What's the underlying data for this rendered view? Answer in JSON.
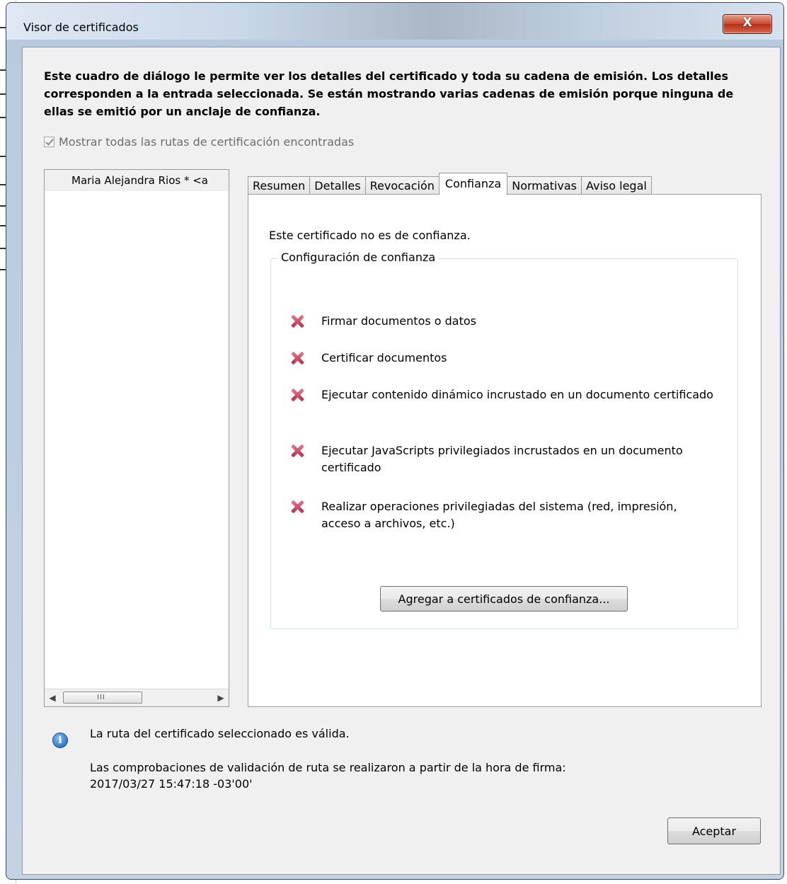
{
  "window": {
    "title": "Visor de certificados",
    "close_glyph": "X"
  },
  "intro": "Este cuadro de diálogo le permite ver los detalles del certificado y toda su cadena de emisión. Los detalles corresponden a la entrada seleccionada. Se están mostrando varias cadenas de emisión porque ninguna de ellas se emitió por un anclaje de confianza.",
  "show_all": {
    "label": "Mostrar todas las rutas de certificación encontradas",
    "checked": true,
    "disabled": true
  },
  "tree": {
    "items": [
      {
        "label": "Maria Alejandra  Rios * <a"
      }
    ],
    "scroll_grip": "III"
  },
  "tabs": [
    {
      "label": "Resumen",
      "active": false
    },
    {
      "label": "Detalles",
      "active": false
    },
    {
      "label": "Revocación",
      "active": false
    },
    {
      "label": "Confianza",
      "active": true
    },
    {
      "label": "Normativas",
      "active": false
    },
    {
      "label": "Aviso legal",
      "active": false
    }
  ],
  "trust": {
    "status": "Este certificado no es de confianza.",
    "group_title": "Configuración de confianza",
    "permissions": [
      {
        "text": "Firmar documentos o datos",
        "icon": "red-x-icon"
      },
      {
        "text": "Certificar documentos",
        "icon": "red-x-icon"
      },
      {
        "text": "Ejecutar contenido dinámico incrustado en un documento certificado",
        "icon": "red-x-icon"
      },
      {
        "text": "Ejecutar JavaScripts privilegiados incrustados en un documento certificado",
        "icon": "red-x-icon"
      },
      {
        "text": "Realizar operaciones privilegiadas del sistema (red, impresión, acceso a archivos, etc.)",
        "icon": "red-x-icon"
      }
    ],
    "add_button": "Agregar a certificados de confianza..."
  },
  "footer": {
    "info_icon": "i",
    "valid_message": "La ruta del certificado seleccionado es válida.",
    "check_message_line1": "Las comprobaciones de validación de ruta se realizaron a partir de la hora de firma:",
    "check_message_line2": "2017/03/27 15:47:18 -03'00'",
    "ok_button": "Aceptar"
  },
  "colors": {
    "x_icon": "#c0354d",
    "close_button": "#c8462d",
    "info_icon": "#2f78c6"
  }
}
